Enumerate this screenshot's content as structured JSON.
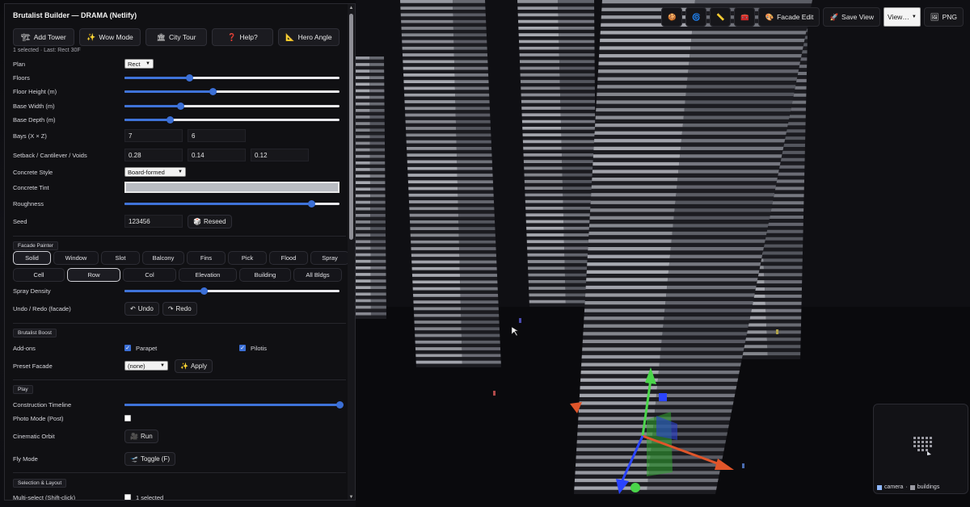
{
  "panel": {
    "title": "Brutalist Builder — DRAMA (Netlify)",
    "status": "1 selected · Last: Rect 30F",
    "toolbar": [
      {
        "icon": "🏗",
        "label": "Add Tower"
      },
      {
        "icon": "✨",
        "label": "Wow Mode"
      },
      {
        "icon": "🏛",
        "label": "City Tour"
      },
      {
        "icon": "❓",
        "label": "Help?"
      },
      {
        "icon": "📐",
        "label": "Hero Angle"
      }
    ],
    "plan": {
      "label": "Plan",
      "value": "Rect"
    },
    "sliders": [
      {
        "label": "Floors",
        "value": 0.3
      },
      {
        "label": "Floor Height (m)",
        "value": 0.41
      },
      {
        "label": "Base Width (m)",
        "value": 0.26
      },
      {
        "label": "Base Depth (m)",
        "value": 0.21
      }
    ],
    "bays": {
      "label": "Bays (X × Z)",
      "x": "7",
      "z": "6"
    },
    "setback": {
      "label": "Setback / Cantilever / Voids",
      "a": "0.28",
      "b": "0.14",
      "c": "0.12"
    },
    "concrete_style": {
      "label": "Concrete Style",
      "value": "Board-formed"
    },
    "concrete_tint": {
      "label": "Concrete Tint",
      "color": "#b9bcc2"
    },
    "roughness": {
      "label": "Roughness",
      "value": 0.87
    },
    "seed": {
      "label": "Seed",
      "value": "123456",
      "button_icon": "🎲",
      "button_label": "Reseed"
    },
    "facade": {
      "section": "Facade Painter",
      "row1": [
        "Solid",
        "Window",
        "Slot",
        "Balcony",
        "Fins",
        "Pick",
        "Flood",
        "Spray"
      ],
      "row2": [
        "Cell",
        "Row",
        "Col",
        "Elevation",
        "Building",
        "All Bldgs"
      ],
      "active1": "Solid",
      "active2": "Row",
      "spray_label": "Spray Density",
      "spray_value": 0.37,
      "undo_label": "Undo / Redo (facade)",
      "undo_icon": "↶",
      "undo": "Undo",
      "redo_icon": "↷",
      "redo": "Redo"
    },
    "boost": {
      "section": "Brutalist Boost",
      "addons_label": "Add-ons",
      "parapet": "Parapet",
      "pilotis": "Pilotis",
      "preset_label": "Preset Facade",
      "preset_value": "(none)",
      "apply_icon": "✨",
      "apply": "Apply"
    },
    "play": {
      "section": "Play",
      "timeline_label": "Construction Timeline",
      "timeline_value": 1.0,
      "photo_label": "Photo Mode (Post)",
      "orbit_label": "Cinematic Orbit",
      "orbit_icon": "🎥",
      "orbit_btn": "Run",
      "fly_label": "Fly Mode",
      "fly_icon": "🛫",
      "fly_btn": "Toggle (F)"
    },
    "selection": {
      "section": "Selection & Layout",
      "multi_label": "Multi-select (Shift-click)",
      "multi_value": "1 selected"
    }
  },
  "topbar": {
    "icons": [
      "🍪",
      "🌀",
      "📏",
      "🧰"
    ],
    "facade_icon": "🎨",
    "facade_edit": "Facade Edit",
    "save_icon": "🚀",
    "save_view": "Save View",
    "view_select": "View…",
    "png_icon": "🖼",
    "png": "PNG"
  },
  "minimap": {
    "camera": "camera",
    "buildings": "buildings",
    "camera_color": "#8fb8ff",
    "buildings_color": "#9a9aa2"
  }
}
